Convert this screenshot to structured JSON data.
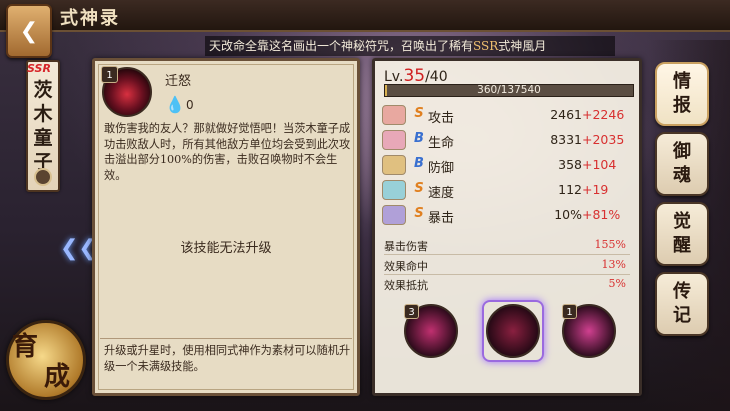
{
  "header": {
    "title": "式神录",
    "back_icon": "back-arrow-icon"
  },
  "ticker": {
    "text_prefix": "天改命全靠这名画出一个神秘符咒，召唤出了稀有",
    "text_ssr": "SSR",
    "text_suffix": "式神風月"
  },
  "shikigami": {
    "rarity": "SSR",
    "name_chars": [
      "茨",
      "木",
      "童",
      "子"
    ]
  },
  "skill": {
    "level": "1",
    "name": "迁怒",
    "cost": "0",
    "description": "敢伤害我的友人？那就做好觉悟吧！当茨木童子成功击败敌人时，所有其他敌方单位均会受到此次攻击溢出部分100%的伤害，击败召唤物时不会生效。",
    "upgrade_note": "该技能无法升级",
    "footer": "升级或升星时，使用相同式神作为素材可以随机升级一个未满级技能。"
  },
  "level": {
    "label": "Lv.",
    "current": "35",
    "max": "/40",
    "exp_text": "360/137540",
    "exp_fraction": 0.003
  },
  "stats": [
    {
      "icon": "attack-icon",
      "grade": "S",
      "grade_color": "#e08020",
      "label": "攻击",
      "base": "2461",
      "bonus": "+2246",
      "icon_color": "#e8a8a0"
    },
    {
      "icon": "health-icon",
      "grade": "B",
      "grade_color": "#3a70d0",
      "label": "生命",
      "base": "8331",
      "bonus": "+2035",
      "icon_color": "#e8a8b8"
    },
    {
      "icon": "defense-icon",
      "grade": "B",
      "grade_color": "#3a70d0",
      "label": "防御",
      "base": "358",
      "bonus": "+104",
      "icon_color": "#e0c080"
    },
    {
      "icon": "speed-icon",
      "grade": "S",
      "grade_color": "#e08020",
      "label": "速度",
      "base": "112",
      "bonus": "+19",
      "icon_color": "#98d0d8"
    },
    {
      "icon": "crit-icon",
      "grade": "S",
      "grade_color": "#e08020",
      "label": "暴击",
      "base": "10%",
      "bonus": "+81%",
      "icon_color": "#b0a0d8"
    }
  ],
  "sub_stats": [
    {
      "label": "暴击伤害",
      "value": "155%"
    },
    {
      "label": "效果命中",
      "value": "13%"
    },
    {
      "label": "效果抵抗",
      "value": "5%"
    }
  ],
  "skill_slots": [
    {
      "level": "3",
      "color": "#c03070"
    },
    {
      "level": "",
      "color": "#8a2040"
    },
    {
      "level": "1",
      "color": "#d04090"
    }
  ],
  "tabs": [
    {
      "label1": "情",
      "label2": "报"
    },
    {
      "label1": "御",
      "label2": "魂"
    },
    {
      "label1": "觉",
      "label2": "醒"
    },
    {
      "label1": "传",
      "label2": "记"
    }
  ],
  "yucheng": {
    "char1": "育",
    "char2": "成"
  }
}
